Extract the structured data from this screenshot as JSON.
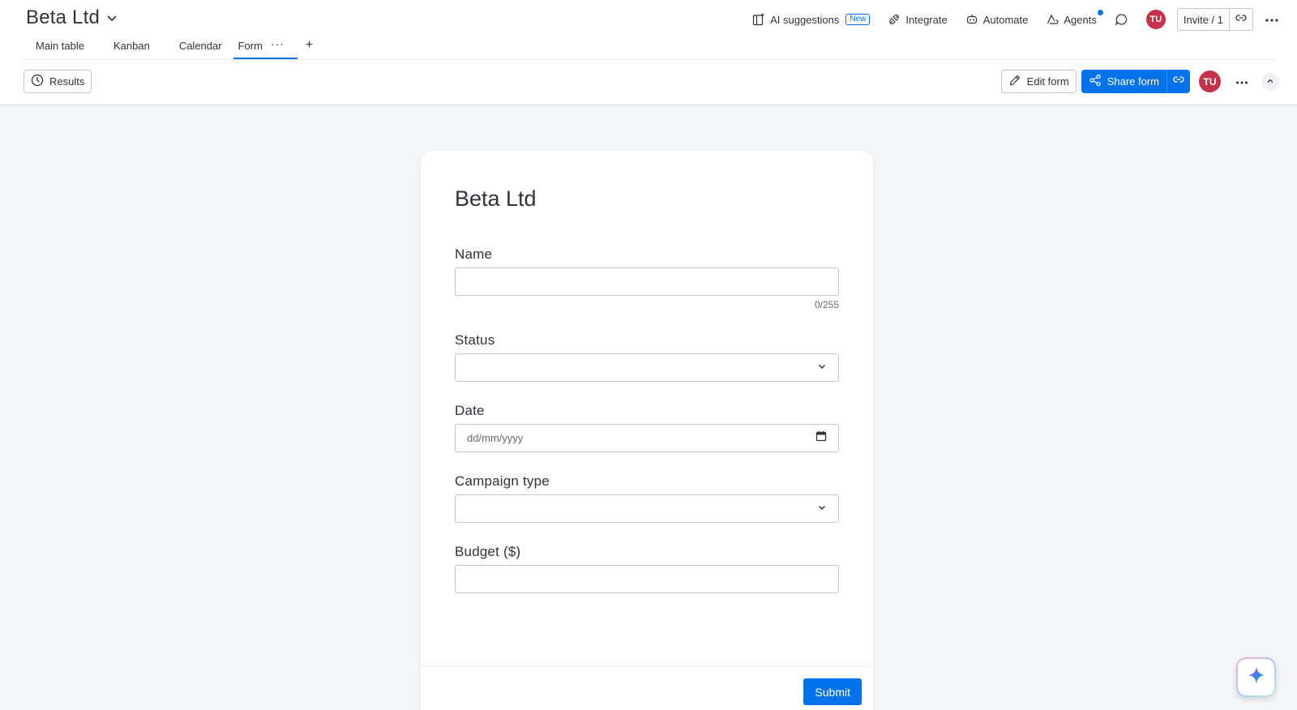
{
  "board": {
    "title": "Beta Ltd"
  },
  "top_actions": {
    "ai_suggestions": "AI suggestions",
    "new_badge": "New",
    "integrate": "Integrate",
    "automate": "Automate",
    "agents": "Agents",
    "avatar_initials": "TU",
    "invite": "Invite / 1"
  },
  "tabs": [
    {
      "label": "Main table"
    },
    {
      "label": "Kanban"
    },
    {
      "label": "Calendar"
    },
    {
      "label": "Form",
      "active": true
    }
  ],
  "toolbar": {
    "results": "Results",
    "edit_form": "Edit form",
    "share_form": "Share form",
    "avatar_initials": "TU"
  },
  "form": {
    "title": "Beta Ltd",
    "fields": {
      "name": {
        "label": "Name",
        "value": "",
        "counter": "0/255"
      },
      "status": {
        "label": "Status",
        "value": ""
      },
      "date": {
        "label": "Date",
        "placeholder": "dd/mm/yyyy"
      },
      "campaign_type": {
        "label": "Campaign type",
        "value": ""
      },
      "budget": {
        "label": "Budget ($)",
        "value": ""
      }
    },
    "submit": "Submit"
  },
  "colors": {
    "primary": "#0073ea",
    "avatar": "#c4324c",
    "background": "#f5f6fa",
    "text": "#323338"
  },
  "icons": [
    "chevron-down-icon",
    "ai-suggestions-icon",
    "integrate-icon",
    "automate-icon",
    "agents-icon",
    "chat-icon",
    "link-icon",
    "more-icon",
    "clock-icon",
    "pencil-icon",
    "share-icon",
    "chevron-up-icon",
    "calendar-icon",
    "sparkle-icon"
  ]
}
